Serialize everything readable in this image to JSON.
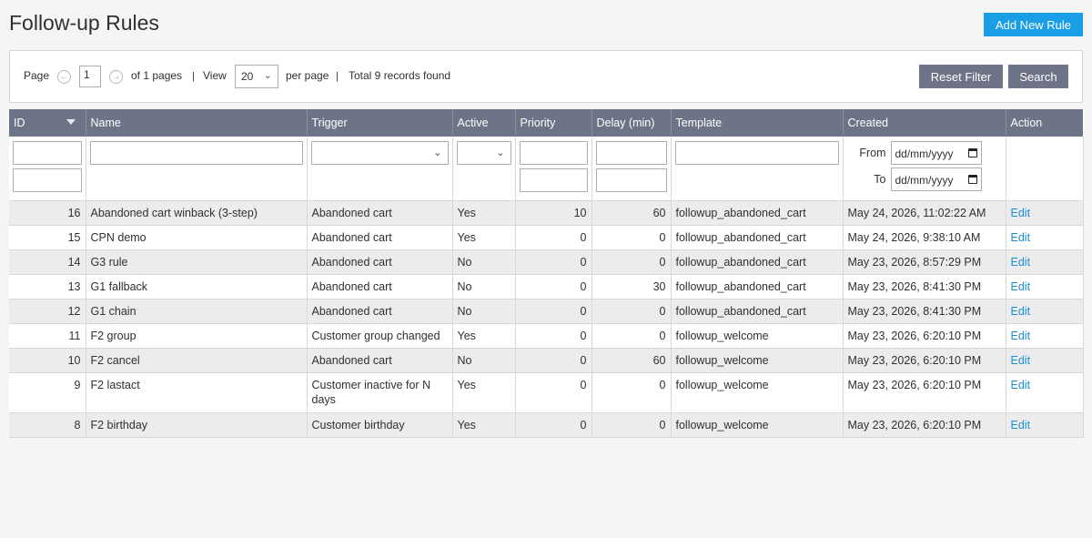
{
  "page": {
    "title": "Follow-up Rules",
    "add_button": "Add New Rule"
  },
  "pager": {
    "page_label": "Page",
    "page_value": "1",
    "of_pages": "of 1 pages",
    "view_label": "View",
    "view_value": "20",
    "per_page": "per page",
    "total": "Total 9 records found",
    "reset_button": "Reset Filter",
    "search_button": "Search",
    "separator": "|"
  },
  "columns": [
    "ID",
    "Name",
    "Trigger",
    "Active",
    "Priority",
    "Delay (min)",
    "Template",
    "Created",
    "Action"
  ],
  "filters": {
    "from_label": "From",
    "to_label": "To",
    "date_placeholder": "dd/mm/yyyy"
  },
  "rows": [
    {
      "id": "16",
      "name": "Abandoned cart winback (3-step)",
      "trigger": "Abandoned cart",
      "active": "Yes",
      "priority": "10",
      "delay": "60",
      "template": "followup_abandoned_cart",
      "created": "May 24, 2026, 11:02:22 AM",
      "action": "Edit"
    },
    {
      "id": "15",
      "name": "CPN demo",
      "trigger": "Abandoned cart",
      "active": "Yes",
      "priority": "0",
      "delay": "0",
      "template": "followup_abandoned_cart",
      "created": "May 24, 2026, 9:38:10 AM",
      "action": "Edit"
    },
    {
      "id": "14",
      "name": "G3 rule",
      "trigger": "Abandoned cart",
      "active": "No",
      "priority": "0",
      "delay": "0",
      "template": "followup_abandoned_cart",
      "created": "May 23, 2026, 8:57:29 PM",
      "action": "Edit"
    },
    {
      "id": "13",
      "name": "G1 fallback",
      "trigger": "Abandoned cart",
      "active": "No",
      "priority": "0",
      "delay": "30",
      "template": "followup_abandoned_cart",
      "created": "May 23, 2026, 8:41:30 PM",
      "action": "Edit"
    },
    {
      "id": "12",
      "name": "G1 chain",
      "trigger": "Abandoned cart",
      "active": "No",
      "priority": "0",
      "delay": "0",
      "template": "followup_abandoned_cart",
      "created": "May 23, 2026, 8:41:30 PM",
      "action": "Edit"
    },
    {
      "id": "11",
      "name": "F2 group",
      "trigger": "Customer group changed",
      "active": "Yes",
      "priority": "0",
      "delay": "0",
      "template": "followup_welcome",
      "created": "May 23, 2026, 6:20:10 PM",
      "action": "Edit"
    },
    {
      "id": "10",
      "name": "F2 cancel",
      "trigger": "Abandoned cart",
      "active": "No",
      "priority": "0",
      "delay": "60",
      "template": "followup_welcome",
      "created": "May 23, 2026, 6:20:10 PM",
      "action": "Edit"
    },
    {
      "id": "9",
      "name": "F2 lastact",
      "trigger": "Customer inactive for N days",
      "active": "Yes",
      "priority": "0",
      "delay": "0",
      "template": "followup_welcome",
      "created": "May 23, 2026, 6:20:10 PM",
      "action": "Edit"
    },
    {
      "id": "8",
      "name": "F2 birthday",
      "trigger": "Customer birthday",
      "active": "Yes",
      "priority": "0",
      "delay": "0",
      "template": "followup_welcome",
      "created": "May 23, 2026, 6:20:10 PM",
      "action": "Edit"
    }
  ]
}
